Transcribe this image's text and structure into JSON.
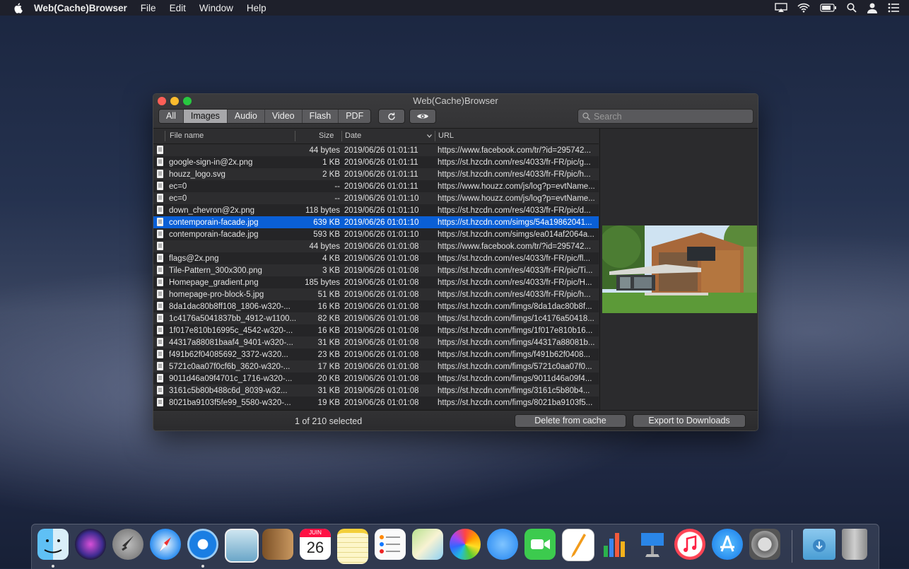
{
  "menubar": {
    "app_name": "Web(Cache)Browser",
    "items": [
      "File",
      "Edit",
      "Window",
      "Help"
    ]
  },
  "window": {
    "title": "Web(Cache)Browser",
    "filters": [
      "All",
      "Images",
      "Audio",
      "Video",
      "Flash",
      "PDF"
    ],
    "selected_filter": "Images",
    "search_placeholder": "Search",
    "columns": {
      "name": "File name",
      "size": "Size",
      "date": "Date",
      "url": "URL"
    },
    "rows": [
      {
        "name": "",
        "size": "44 bytes",
        "date": "2019/06/26 01:01:11",
        "url": "https://www.facebook.com/tr/?id=295742..."
      },
      {
        "name": "google-sign-in@2x.png",
        "size": "1 KB",
        "date": "2019/06/26 01:01:11",
        "url": "https://st.hzcdn.com/res/4033/fr-FR/pic/g..."
      },
      {
        "name": "houzz_logo.svg",
        "size": "2 KB",
        "date": "2019/06/26 01:01:11",
        "url": "https://st.hzcdn.com/res/4033/fr-FR/pic/h..."
      },
      {
        "name": "ec=0",
        "size": "--",
        "date": "2019/06/26 01:01:11",
        "url": "https://www.houzz.com/js/log?p=evtName..."
      },
      {
        "name": "ec=0",
        "size": "--",
        "date": "2019/06/26 01:01:10",
        "url": "https://www.houzz.com/js/log?p=evtName..."
      },
      {
        "name": "down_chevron@2x.png",
        "size": "118 bytes",
        "date": "2019/06/26 01:01:10",
        "url": "https://st.hzcdn.com/res/4033/fr-FR/pic/d..."
      },
      {
        "name": "contemporain-facade.jpg",
        "size": "639 KB",
        "date": "2019/06/26 01:01:10",
        "url": "https://st.hzcdn.com/simgs/54a19862041...",
        "selected": true
      },
      {
        "name": "contemporain-facade.jpg",
        "size": "593 KB",
        "date": "2019/06/26 01:01:10",
        "url": "https://st.hzcdn.com/simgs/ea014af2064a..."
      },
      {
        "name": "",
        "size": "44 bytes",
        "date": "2019/06/26 01:01:08",
        "url": "https://www.facebook.com/tr/?id=295742..."
      },
      {
        "name": "flags@2x.png",
        "size": "4 KB",
        "date": "2019/06/26 01:01:08",
        "url": "https://st.hzcdn.com/res/4033/fr-FR/pic/fl..."
      },
      {
        "name": "Tile-Pattern_300x300.png",
        "size": "3 KB",
        "date": "2019/06/26 01:01:08",
        "url": "https://st.hzcdn.com/res/4033/fr-FR/pic/Ti..."
      },
      {
        "name": "Homepage_gradient.png",
        "size": "185 bytes",
        "date": "2019/06/26 01:01:08",
        "url": "https://st.hzcdn.com/res/4033/fr-FR/pic/H..."
      },
      {
        "name": "homepage-pro-block-5.jpg",
        "size": "51 KB",
        "date": "2019/06/26 01:01:08",
        "url": "https://st.hzcdn.com/res/4033/fr-FR/pic/h..."
      },
      {
        "name": "8da1dac80b8ff108_1806-w320-...",
        "size": "16 KB",
        "date": "2019/06/26 01:01:08",
        "url": "https://st.hzcdn.com/fimgs/8da1dac80b8f..."
      },
      {
        "name": "1c4176a5041837bb_4912-w1100...",
        "size": "82 KB",
        "date": "2019/06/26 01:01:08",
        "url": "https://st.hzcdn.com/fimgs/1c4176a50418..."
      },
      {
        "name": "1f017e810b16995c_4542-w320-...",
        "size": "16 KB",
        "date": "2019/06/26 01:01:08",
        "url": "https://st.hzcdn.com/fimgs/1f017e810b16..."
      },
      {
        "name": "44317a88081baaf4_9401-w320-...",
        "size": "31 KB",
        "date": "2019/06/26 01:01:08",
        "url": "https://st.hzcdn.com/fimgs/44317a88081b..."
      },
      {
        "name": "f491b62f04085692_3372-w320...",
        "size": "23 KB",
        "date": "2019/06/26 01:01:08",
        "url": "https://st.hzcdn.com/fimgs/f491b62f0408..."
      },
      {
        "name": "5721c0aa07f0cf6b_3620-w320-...",
        "size": "17 KB",
        "date": "2019/06/26 01:01:08",
        "url": "https://st.hzcdn.com/fimgs/5721c0aa07f0..."
      },
      {
        "name": "9011d46a09f4701c_1716-w320-...",
        "size": "20 KB",
        "date": "2019/06/26 01:01:08",
        "url": "https://st.hzcdn.com/fimgs/9011d46a09f4..."
      },
      {
        "name": "3161c5b80b488c6d_8039-w32...",
        "size": "31 KB",
        "date": "2019/06/26 01:01:08",
        "url": "https://st.hzcdn.com/fimgs/3161c5b80b4..."
      },
      {
        "name": "8021ba9103f5fe99_5580-w320-...",
        "size": "19 KB",
        "date": "2019/06/26 01:01:08",
        "url": "https://st.hzcdn.com/fimgs/8021ba9103f5..."
      }
    ],
    "status": "1 of 210 selected",
    "delete_label": "Delete from cache",
    "export_label": "Export to Downloads"
  },
  "dock": {
    "calendar_month": "JUIN",
    "calendar_day": "26",
    "icons": [
      "finder-icon",
      "siri-icon",
      "launchpad-icon",
      "safari-icon",
      "webcachebrowser-icon",
      "mail-icon",
      "contacts-icon",
      "calendar-icon",
      "notes-icon",
      "reminders-icon",
      "maps-icon",
      "photos-icon",
      "messages-icon",
      "facetime-icon",
      "pages-icon",
      "numbers-icon",
      "keynote-icon",
      "itunes-icon",
      "app-store-icon",
      "system-preferences-icon",
      "downloads-folder-icon",
      "trash-icon"
    ]
  },
  "colors": {
    "selection": "#0a5fd6",
    "close": "#fc5f57",
    "minimize": "#fdbc2e",
    "zoom": "#28c840"
  }
}
